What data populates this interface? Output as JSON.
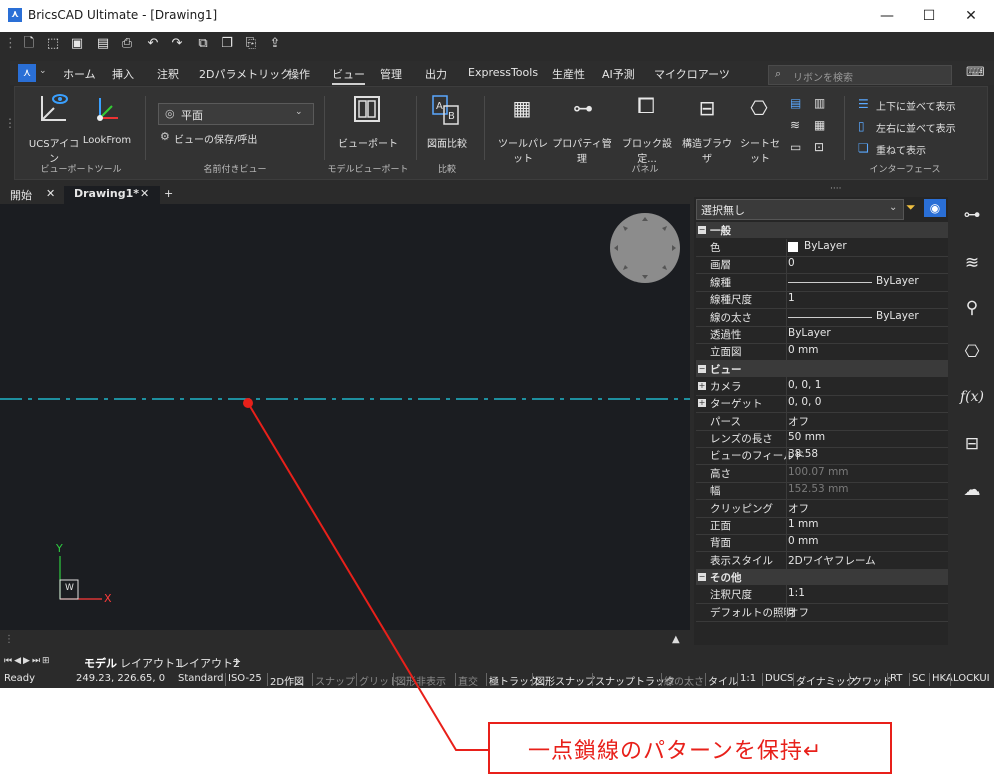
{
  "window": {
    "title": "BricsCAD Ultimate - [Drawing1]",
    "minimize": "—",
    "maximize": "☐",
    "close": "✕"
  },
  "menu": {
    "app_icon": "bricscad-logo",
    "items": [
      "ホーム",
      "挿入",
      "注釈",
      "2Dパラメトリック",
      "操作",
      "ビュー",
      "管理",
      "出力",
      "ExpressTools",
      "生産性",
      "AI予測",
      "マイクロアーツ"
    ],
    "active": "ビュー",
    "search_placeholder": "リボンを検索"
  },
  "ribbon": {
    "ucs_icon": "UCSアイコン",
    "lookfrom": "LookFrom",
    "group_viewport_tools": "ビューポートツール",
    "view_select": "平面",
    "view_save": "ビューの保存/呼出",
    "group_named_views": "名前付きビュー",
    "viewport": "ビューポート",
    "group_model_viewport": "モデルビューポート",
    "compare": "図面比較",
    "group_compare": "比較",
    "tool_palette": "ツールパレット",
    "property_mgr": "プロパティ管理",
    "block_settings": "ブロック設定...",
    "struct_browser": "構造ブラウザ",
    "sheet_set": "シートセット",
    "group_panel": "パネル",
    "tile_horizontal": "上下に並べて表示",
    "tile_vertical": "左右に並べて表示",
    "cascade": "重ねて表示",
    "group_interface": "インターフェース"
  },
  "tabs": {
    "start": "開始",
    "drawing": "Drawing1*",
    "close": "✕",
    "add": "+"
  },
  "canvas": {
    "ucs_y": "Y",
    "ucs_x": "X",
    "ucs_w": "W"
  },
  "layouts": {
    "model": "モデル",
    "layout1": "レイアウト1",
    "layout2": "レイアウト2",
    "add": "+"
  },
  "properties": {
    "selection": "選択無し",
    "general": "一般",
    "rows_general": [
      {
        "k": "色",
        "v": "ByLayer"
      },
      {
        "k": "画層",
        "v": "0"
      },
      {
        "k": "線種",
        "v": "ByLayer"
      },
      {
        "k": "線種尺度",
        "v": "1"
      },
      {
        "k": "線の太さ",
        "v": "ByLayer"
      },
      {
        "k": "透過性",
        "v": "ByLayer"
      },
      {
        "k": "立面図",
        "v": "0 mm"
      }
    ],
    "view": "ビュー",
    "rows_view": [
      {
        "k": "カメラ",
        "v": "0, 0, 1"
      },
      {
        "k": "ターゲット",
        "v": "0, 0, 0"
      },
      {
        "k": "パース",
        "v": "オフ"
      },
      {
        "k": "レンズの長さ",
        "v": "50 mm"
      },
      {
        "k": "ビューのフィールド",
        "v": "38.58"
      },
      {
        "k": "高さ",
        "v": "100.07 mm"
      },
      {
        "k": "幅",
        "v": "152.53 mm"
      },
      {
        "k": "クリッピング",
        "v": "オフ"
      },
      {
        "k": "正面",
        "v": "1 mm"
      },
      {
        "k": "背面",
        "v": "0 mm"
      },
      {
        "k": "表示スタイル",
        "v": "2Dワイヤフレーム"
      }
    ],
    "other": "その他",
    "rows_other": [
      {
        "k": "注釈尺度",
        "v": "1:1"
      },
      {
        "k": "デフォルトの照明",
        "v": "オフ"
      }
    ]
  },
  "status": {
    "ready": "Ready",
    "coords": "249.23, 226.65, 0",
    "items": [
      "Standard",
      "ISO-25",
      "2D作図",
      "スナップ",
      "グリッド",
      "図形非表示",
      "直交",
      "極トラック",
      "図形スナップ",
      "スナップトラック",
      "線の太さ",
      "タイル",
      "1:1",
      "DUCS",
      "ダイナミック",
      "クワッド",
      "RT",
      "SC",
      "HKA",
      "LOCKUI"
    ]
  },
  "callout": {
    "text": "一点鎖線のパターンを保持↵"
  },
  "colors": {
    "accent": "#e8201a",
    "linetype": "#1fb5c9"
  }
}
